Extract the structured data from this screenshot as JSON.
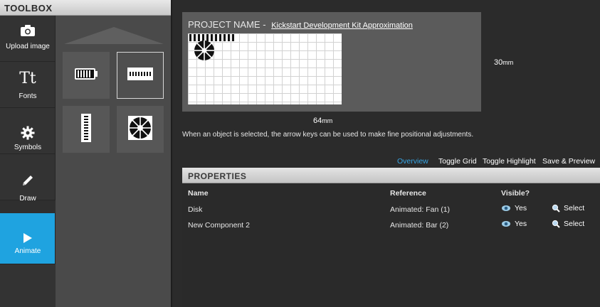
{
  "toolbox": {
    "title": "TOOLBOX",
    "items": [
      {
        "label": "Upload image",
        "icon": "camera-icon"
      },
      {
        "label": "Fonts",
        "icon": "text-tt-icon"
      },
      {
        "label": "Symbols",
        "icon": "gear-icon"
      },
      {
        "label": "Draw",
        "icon": "pencil-icon"
      },
      {
        "label": "Animate",
        "icon": "play-icon",
        "active": true
      }
    ],
    "symbols": [
      {
        "name": "battery-bar-icon",
        "selected": false
      },
      {
        "name": "horizontal-bar-icon",
        "selected": true
      },
      {
        "name": "vertical-bar-icon",
        "selected": false
      },
      {
        "name": "fan-icon",
        "selected": false
      }
    ]
  },
  "workspace": {
    "project_label": "PROJECT NAME -",
    "project_name": "Kickstart Development Kit Approximation",
    "width_value": "64",
    "height_value": "30",
    "unit": "mm",
    "hint": "When an object is selected, the arrow keys can be used to make fine positional adjustments.",
    "tabs": [
      {
        "label": "Overview",
        "active": true
      },
      {
        "label": "Toggle Grid",
        "active": false
      },
      {
        "label": "Toggle Highlight",
        "active": false
      },
      {
        "label": "Save & Preview",
        "active": false
      }
    ]
  },
  "properties": {
    "title": "PROPERTIES",
    "columns": {
      "name": "Name",
      "reference": "Reference",
      "visible": "Visible?"
    },
    "rows": [
      {
        "name": "Disk",
        "reference": "Animated: Fan (1)",
        "visible": "Yes",
        "select": "Select"
      },
      {
        "name": "New Component 2",
        "reference": "Animated: Bar (2)",
        "visible": "Yes",
        "select": "Select"
      }
    ]
  },
  "colors": {
    "accent": "#1fa3e0",
    "active_tab": "#37a6e6"
  }
}
